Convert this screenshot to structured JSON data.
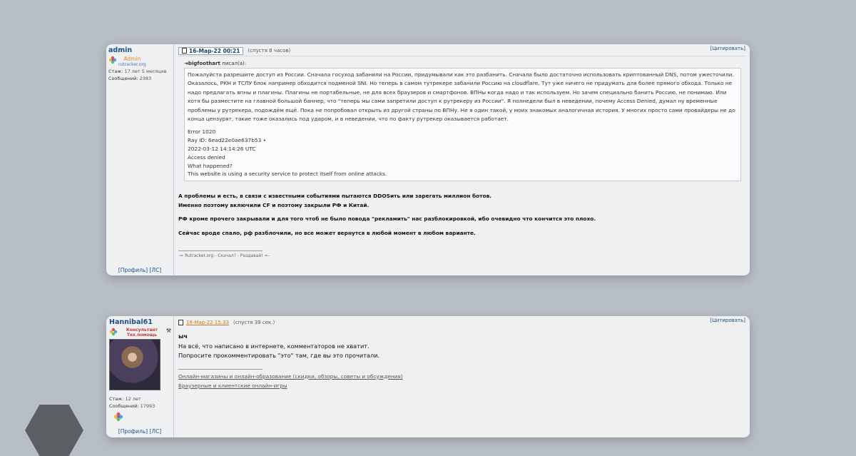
{
  "post1": {
    "username": "admin",
    "rank_title": "Admin",
    "rank_site": "rutracker.org",
    "tenure_label": "Стаж:",
    "tenure_value": "17 лет 5 месяцев",
    "messages_label": "Сообщений:",
    "messages_value": "2383",
    "profile_link": "[Профиль]",
    "pm_link": "[ЛС]",
    "date": "16-Мар-22 00:21",
    "elapsed": "(спустя 8 часов)",
    "cite": "[Цитировать]",
    "quote_author": "bigfoothart",
    "quote_wrote": "писал(а):",
    "quote_text": "Пожалуйста разрешите доступ из России. Сначала госуход забанили на России, придумывали как это разбанить. Сначала было достаточно использовать криптованный DNS, потом ужесточили. Оказалось, РКН и ТСПУ блок например обходится подменой SNI. Но теперь в самом тутрекере забанили Россию на cloudflare. Тут уже ничего не придумать для более прямого обхода. Только не надо предлагать впны и плагины. Плагины не портабельные, не для всех браузеров и смартфонов. ВПНы когда надо и так используем. Но зачем специально банить Россию, не понимаю. Или хотя бы разместите на главной большой баннер, что \"теперь мы сами запретили доступ к рутрекеру из России\". Я полнедели был в неведении, почему Access Denied, думал ну временные проблемы у рутрекера, подождём ещё. Пока не попробовал открыть из другой страны по ВПНу. Не я один такой, у моих знакомых аналогичная история. У многих просто сами провайдеры не до конца цензурят, такие тоже оказались под ударом, и в неведении, что по факту рутрекер оказывается работает.",
    "error_lines": [
      "Error 1020",
      "Ray ID: 6ead22e0ae637b53 •",
      "2022-03-12 14:14:26 UTC",
      "Access denied",
      "What happened?",
      "This website is using a security service to protect itself from online attacks."
    ],
    "reply_line1": "А проблемы и есть, в связи с известными событиями пытаются DDOSить или зарегать миллион ботов.",
    "reply_line2": "Именно поэтому включили CF и поэтому закрыли РФ и Китай.",
    "reply_line3": "РФ кроме прочего закрывали и для того чтоб не было повода \"рекламить\" нас разблокировкой, ибо очевидно что кончится это плохо.",
    "reply_line4": "Сейчас вроде спало, рф разблочили, но все может вернутся в любой момент в любом варианте.",
    "signature": "-= Rutracker.org - Скачал? - Раздавай! =-"
  },
  "post2": {
    "username": "Hannibal61",
    "rank_title": "Консультант Тех.помощь",
    "tenure_label": "Стаж:",
    "tenure_value": "12 лет",
    "messages_label": "Сообщений:",
    "messages_value": "17993",
    "profile_link": "[Профиль]",
    "pm_link": "[ЛС]",
    "date": "18-Мар-22 15:33",
    "elapsed": "(спустя 39 сек.)",
    "cite": "[Цитировать]",
    "line1": "ыч",
    "line2": "На всё, что написано в интернете, комментаторов не хватит.",
    "line3": "Попросите прокомментировать \"это\" там, где вы это прочитали.",
    "sig_link1": "Онлайн-магазины и онлайн-образование (скидки, обзоры, советы и обсуждения)",
    "sig_link2": "Браузерные и клиентские онлайн-игры"
  },
  "colors": {
    "background": "#b8bec6",
    "card": "#eef0f2",
    "username": "#1a4f8a",
    "rank": "#e48a1b"
  }
}
